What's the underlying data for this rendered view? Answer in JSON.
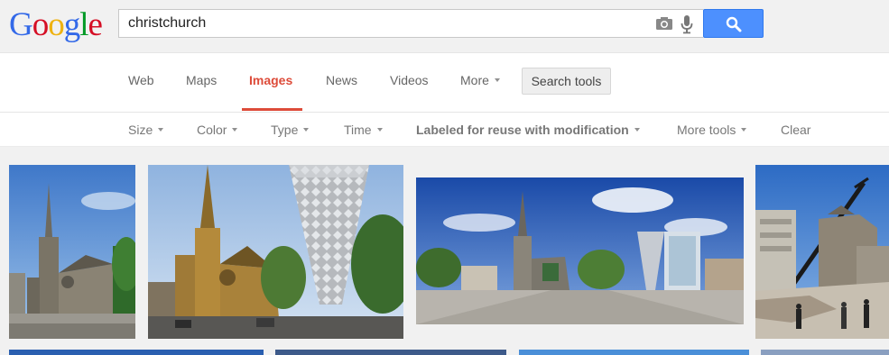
{
  "logo": {
    "letters": [
      {
        "char": "G",
        "color": "#3369e8"
      },
      {
        "char": "o",
        "color": "#d50f25"
      },
      {
        "char": "o",
        "color": "#eeb211"
      },
      {
        "char": "g",
        "color": "#3369e8"
      },
      {
        "char": "l",
        "color": "#009925"
      },
      {
        "char": "e",
        "color": "#d50f25"
      }
    ]
  },
  "search": {
    "query": "christchurch",
    "icons": [
      "camera-icon",
      "mic-icon",
      "search-icon"
    ]
  },
  "nav": {
    "tabs": [
      {
        "label": "Web",
        "active": false
      },
      {
        "label": "Maps",
        "active": false
      },
      {
        "label": "Images",
        "active": true
      },
      {
        "label": "News",
        "active": false
      },
      {
        "label": "Videos",
        "active": false
      },
      {
        "label": "More",
        "active": false,
        "dropdown": true
      }
    ],
    "search_tools": "Search tools"
  },
  "tools": {
    "items": [
      {
        "label": "Size",
        "dropdown": true
      },
      {
        "label": "Color",
        "dropdown": true
      },
      {
        "label": "Type",
        "dropdown": true
      },
      {
        "label": "Time",
        "dropdown": true
      },
      {
        "label": "Labeled for reuse with modification",
        "dropdown": true,
        "selected": true
      },
      {
        "label": "More tools",
        "dropdown": true
      },
      {
        "label": "Clear",
        "dropdown": false
      }
    ]
  },
  "results": {
    "images": [
      {
        "subject": "cathedral-spire-blue-sky"
      },
      {
        "subject": "cathedral-and-chalice-sculpture"
      },
      {
        "subject": "cathedral-square-panorama"
      },
      {
        "subject": "cathedral-earthquake-damage-crane"
      },
      {
        "subject": "blue-sky-strip"
      },
      {
        "subject": "cityscape-strip"
      },
      {
        "subject": "sky-strip"
      },
      {
        "subject": "sky-strip-edge"
      }
    ]
  },
  "colors": {
    "accent_red": "#dd4b39",
    "search_button_blue": "#4d90fe",
    "page_bg": "#f1f1f1"
  }
}
